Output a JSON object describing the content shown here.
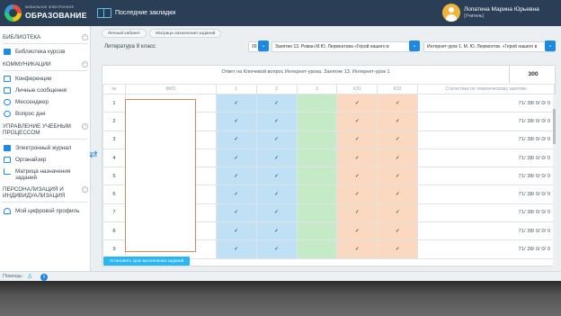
{
  "header": {
    "logo_small": "МОБИЛЬНОЕ ЭЛЕКТРОННОЕ",
    "logo_big": "ОБРАЗОВАНИЕ",
    "bookmarks_label": "Последние закладки",
    "user_name": "Лопатина Марина Юрьевна",
    "user_role": "(Учитель)"
  },
  "sidebar": {
    "sections": [
      {
        "title": "БИБЛИОТЕКА"
      },
      {
        "title": "КОММУНИКАЦИИ"
      },
      {
        "title": "УПРАВЛЕНИЕ УЧЕБНЫМ ПРОЦЕССОМ"
      },
      {
        "title": "ПЕРСОНАЛИЗАЦИЯ И ИНДИВИДУАЛИЗАЦИЯ"
      }
    ],
    "items": [
      {
        "label": "Библиотека курсов",
        "icon": "library-icon"
      },
      {
        "label": "Конференции",
        "icon": "conference-icon"
      },
      {
        "label": "Личные сообщения",
        "icon": "message-icon"
      },
      {
        "label": "Мессенджер",
        "icon": "messenger-icon"
      },
      {
        "label": "Вопрос дня",
        "icon": "question-icon"
      },
      {
        "label": "Электронный журнал",
        "icon": "journal-icon"
      },
      {
        "label": "Органайзер",
        "icon": "organizer-icon"
      },
      {
        "label": "Матрица назначения заданий",
        "icon": "matrix-icon"
      },
      {
        "label": "Мой цифровой профиль",
        "icon": "profile-icon"
      }
    ]
  },
  "breadcrumbs": [
    "Личный кабинет",
    "Матрица назначения заданий"
  ],
  "filters": {
    "subject": "Литература 9 класс",
    "class_value": "09",
    "lesson_value": "Занятие 13. Роман М.Ю. Лермонтова «Герой нашего в",
    "internet_lesson_value": "Интернет-урок 1. М. Ю. Лермонтов. «Герой нашего в"
  },
  "table": {
    "lesson_title": "Ответ на Ключевой вопрос Интернет-урока. Занятие 13. Интернет-урок 1",
    "score": "300",
    "headers": [
      "№",
      "ФИО",
      "1",
      "2",
      "3",
      "КЗ1",
      "КЗ2",
      "Статистика по тематическому занятию"
    ],
    "check": "✓",
    "rows": [
      {
        "num": "1",
        "stat": "71/ 38/ 0/ 0/ 0"
      },
      {
        "num": "2",
        "stat": "71/ 38/ 0/ 0/ 0"
      },
      {
        "num": "3",
        "stat": "71/ 38/ 0/ 0/ 0"
      },
      {
        "num": "4",
        "stat": "71/ 38/ 0/ 0/ 0"
      },
      {
        "num": "5",
        "stat": "71/ 38/ 0/ 0/ 0"
      },
      {
        "num": "6",
        "stat": "71/ 38/ 0/ 0/ 0"
      },
      {
        "num": "7",
        "stat": "71/ 38/ 0/ 0/ 0"
      },
      {
        "num": "8",
        "stat": "71/ 38/ 0/ 0/ 0"
      },
      {
        "num": "9",
        "stat": "71/ 38/ 0/ 0/ 0"
      }
    ]
  },
  "actions": {
    "submit_label": "Установить срок выполнения заданий"
  },
  "footer": {
    "help_label": "Помощь:"
  },
  "colors": {
    "accent": "#1e88e5",
    "header_bg": "#2a3f56",
    "blue_cell": "#bfe0f5",
    "green_cell": "#c4ebc6",
    "orange_cell": "#fbd8c0"
  }
}
